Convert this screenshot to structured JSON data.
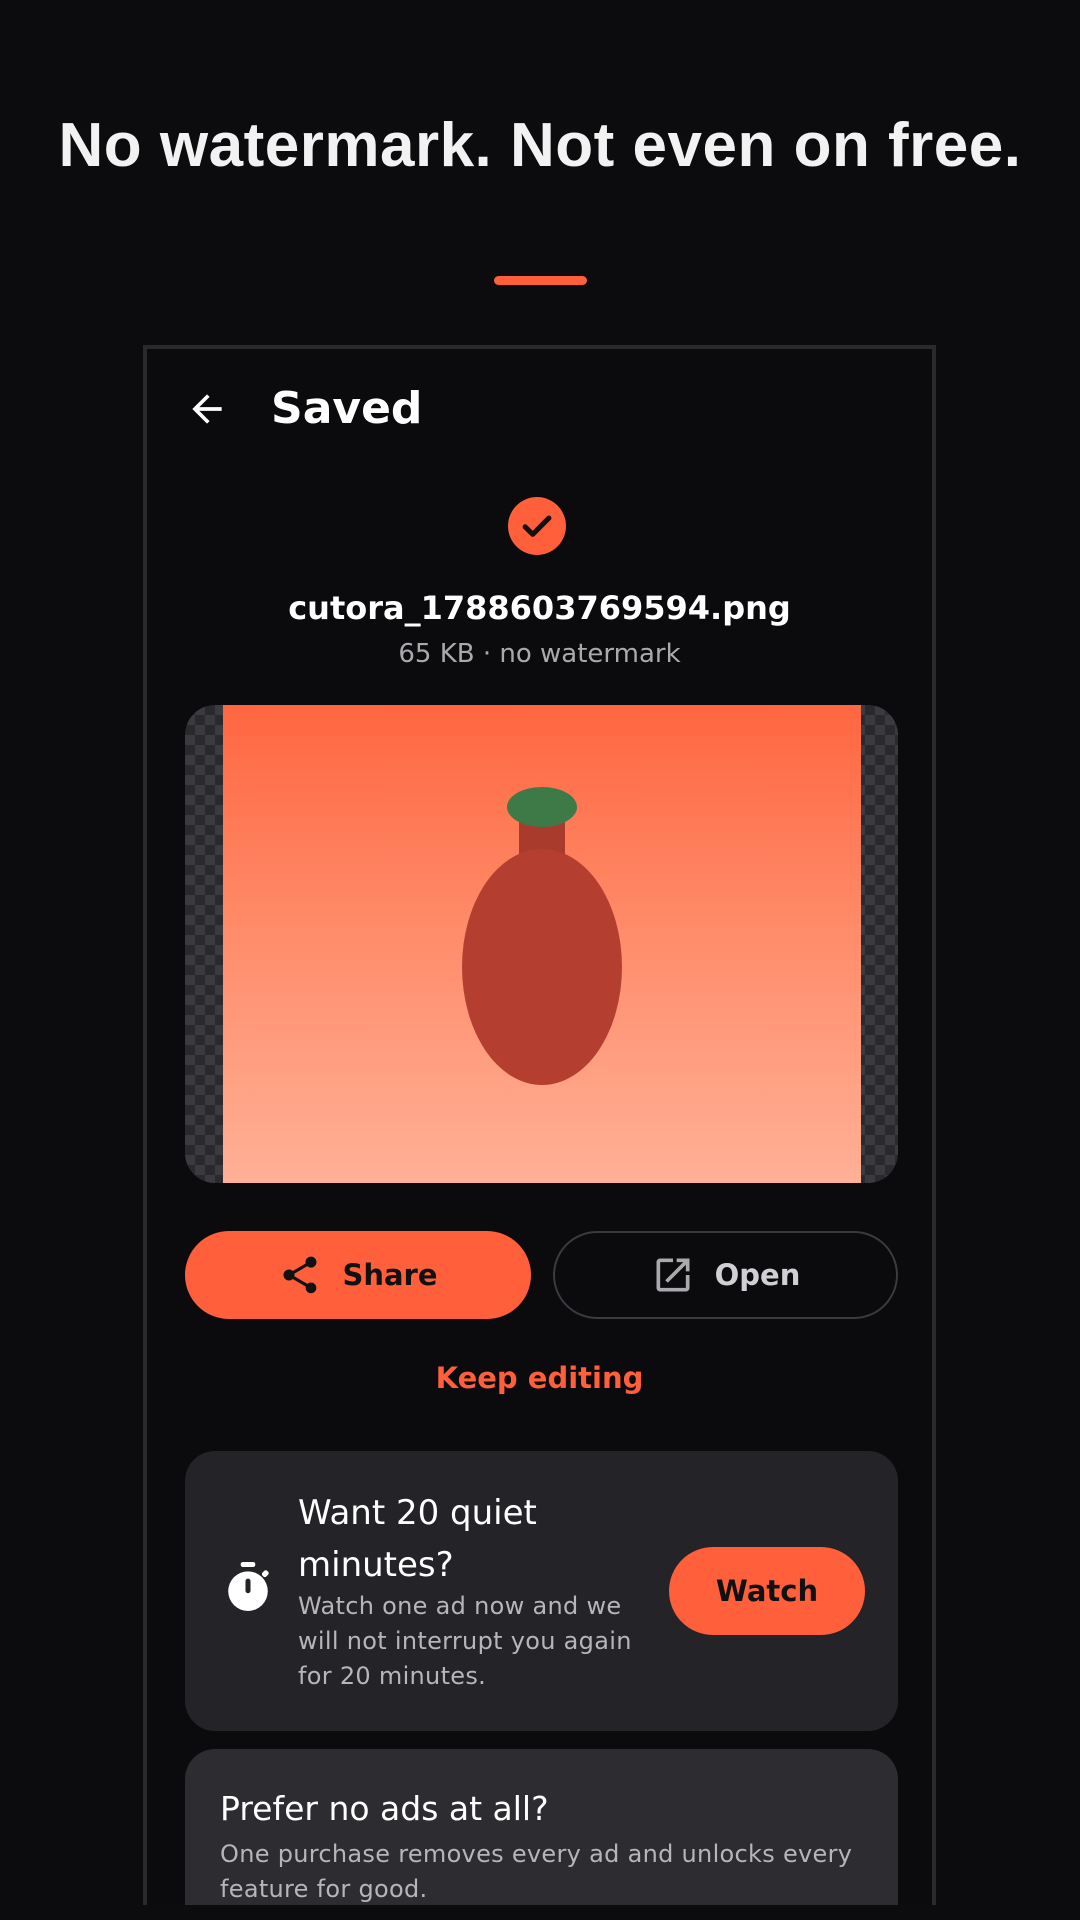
{
  "headline": "No watermark. Not even on free.",
  "colors": {
    "accent": "#ff5f3b",
    "background": "#0c0c0e",
    "card": "#232328",
    "card_alt": "#2c2c31",
    "preview_subject_body": "#b43f30",
    "preview_subject_cap": "#3e7a47"
  },
  "screen": {
    "title": "Saved",
    "back_icon": "arrow-left-icon",
    "success_icon": "check-circle-icon",
    "file_name": "cutora_1788603769594.png",
    "file_meta": "65 KB · no watermark",
    "actions": {
      "share_label": "Share",
      "share_icon": "share-icon",
      "open_label": "Open",
      "open_icon": "open-external-icon"
    },
    "keep_editing_label": "Keep editing",
    "ad_offer": {
      "icon": "stopwatch-icon",
      "title": "Want 20 quiet minutes?",
      "body": "Watch one ad now and we will not interrupt you again for 20 minutes.",
      "button_label": "Watch"
    },
    "upsell": {
      "title": "Prefer no ads at all?",
      "body": "One purchase removes every ad and unlocks every feature for good."
    }
  }
}
